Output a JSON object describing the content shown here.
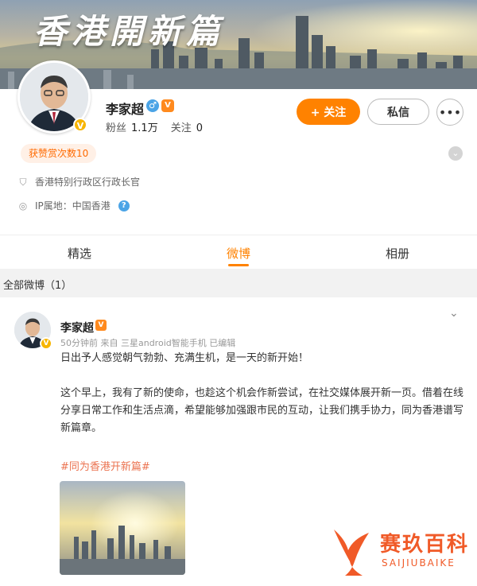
{
  "cover": {
    "title": "香港開新篇"
  },
  "profile": {
    "name": "李家超",
    "gender_icon": "male-icon",
    "followers_label": "粉丝",
    "followers_value": "1.1万",
    "following_label": "关注",
    "following_value": "0",
    "likes_badge": "获赞赏次数10",
    "title_info": "香港特别行政区行政长官",
    "ip_info": "IP属地：中国香港"
  },
  "actions": {
    "follow_label": "+ 关注",
    "message_label": "私信",
    "more_label": "•••"
  },
  "tabs": [
    {
      "label": "精选",
      "active": false
    },
    {
      "label": "微博",
      "active": true
    },
    {
      "label": "相册",
      "active": false
    }
  ],
  "section": {
    "label": "全部微博（1）"
  },
  "post": {
    "author": "李家超",
    "meta": "50分钟前  来自 三星android智能手机 已编辑",
    "paragraph1": "日出予人感觉朝气勃勃、充满生机，是一天的新开始！",
    "paragraph2": "这个早上，我有了新的使命，也趁这个机会作新尝试，在社交媒体展开新一页。借着在线分享日常工作和生活点滴，希望能够加强跟市民的互动，让我们携手协力，同为香港谱写新篇章。",
    "hashtag": "#同为香港开新篇#"
  },
  "watermark": {
    "name": "赛玖百科",
    "sub": "SAIJIUBAIKE"
  },
  "colors": {
    "accent": "#ff8200",
    "hashtag": "#eb7350",
    "verified": "#f7b500"
  }
}
